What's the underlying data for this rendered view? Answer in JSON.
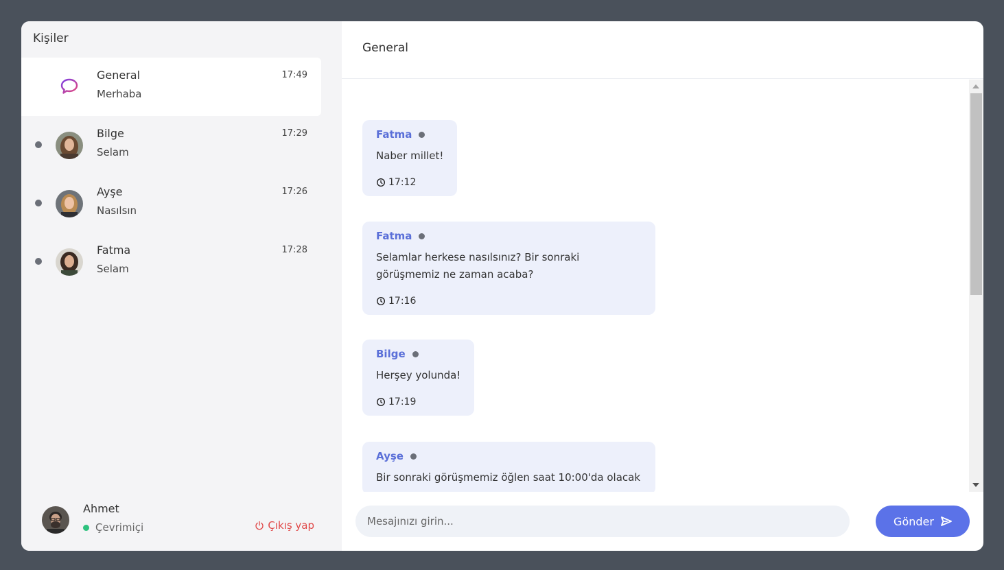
{
  "sidebar": {
    "title": "Kişiler",
    "contacts": [
      {
        "name": "General",
        "last_message": "Merhaba",
        "time": "17:49",
        "icon": "chat-bubble-icon",
        "active": true
      },
      {
        "name": "Bilge",
        "last_message": "Selam",
        "time": "17:29",
        "status": "offline"
      },
      {
        "name": "Ayşe",
        "last_message": "Nasılsın",
        "time": "17:26",
        "status": "offline"
      },
      {
        "name": "Fatma",
        "last_message": "Selam",
        "time": "17:28",
        "status": "offline"
      }
    ],
    "current_user": {
      "name": "Ahmet",
      "status": "Çevrimiçi",
      "logout_label": "Çıkış yap"
    }
  },
  "chat": {
    "title": "General",
    "messages": [
      {
        "sender": "Fatma",
        "text": "Naber millet!",
        "time": "17:12"
      },
      {
        "sender": "Fatma",
        "text": "Selamlar herkese nasılsınız? Bir sonraki görüşmemiz ne zaman acaba?",
        "time": "17:16"
      },
      {
        "sender": "Bilge",
        "text": "Herşey yolunda!",
        "time": "17:19"
      },
      {
        "sender": "Ayşe",
        "text": "Bir sonraki görüşmemiz öğlen saat 10:00'da olacak",
        "time": ""
      }
    ],
    "input_placeholder": "Mesajınızı girin...",
    "send_label": "Gönder"
  },
  "colors": {
    "accent": "#5b72e8",
    "sender_name": "#5a6fd8",
    "online": "#2ec27e",
    "logout": "#e04848",
    "bubble_bg": "#edf0fb",
    "backdrop": "#4a515b"
  }
}
